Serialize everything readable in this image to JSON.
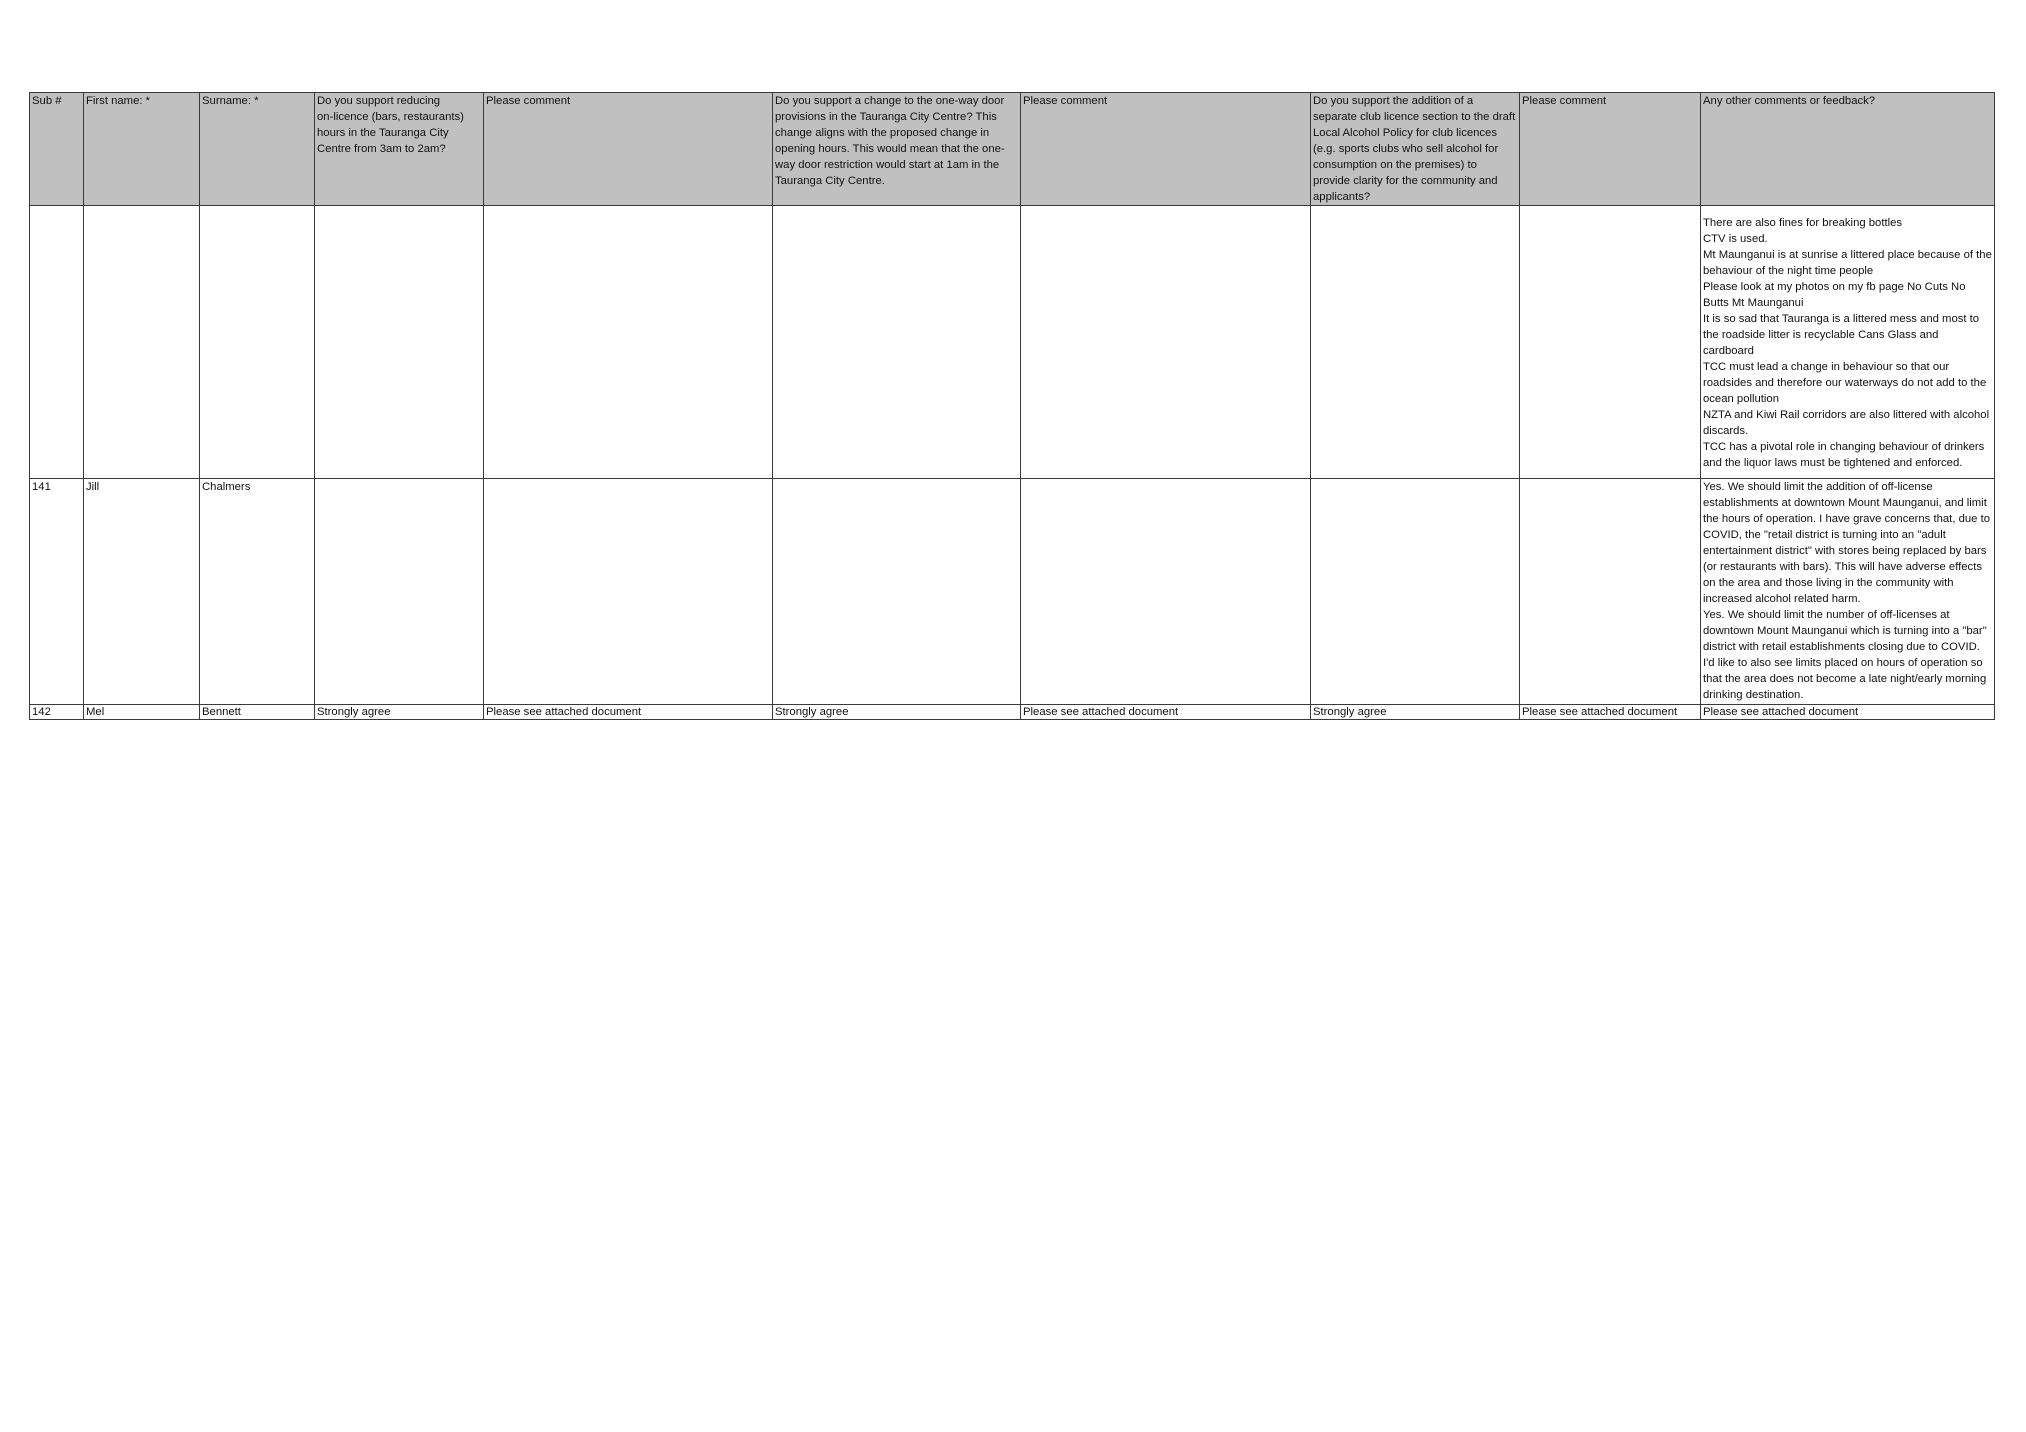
{
  "table": {
    "headers": [
      "Sub #",
      "First name: *",
      "Surname: *",
      "Do you support reducing\n on-licence (bars, restaurants) hours in the Tauranga City Centre from 3am to 2am?",
      "Please comment",
      "Do you support a change to the one-way door provisions in the Tauranga City Centre? This change aligns with the proposed change in opening hours. This would mean that the one-way door restriction would start at 1am in the Tauranga City Centre.",
      "Please comment",
      "Do you support the addition of a separate club licence section to the draft Local Alcohol Policy for club licences (e.g. sports clubs who sell alcohol for consumption on the premises) to provide clarity for the community and applicants?",
      "Please comment",
      "Any other comments or feedback?"
    ],
    "rows": [
      {
        "sub": "",
        "first": "",
        "surname": "",
        "q1": "",
        "c1": "",
        "q2": "",
        "c2": "",
        "q3": "",
        "c3": "",
        "other": [
          "There are also fines for breaking bottles",
          "CTV is used.",
          "Mt Maunganui is at sunrise a littered place because of the behaviour of the night time people",
          "Please look at my photos on my fb page No Cuts No Butts Mt Maunganui",
          "It is so sad that Tauranga is a littered mess and most to the roadside litter is recyclable Cans Glass and cardboard",
          "TCC must lead a change in behaviour so that our roadsides and therefore our waterways do not add to the ocean pollution",
          "NZTA and Kiwi Rail corridors are also littered with alcohol discards.",
          "TCC has a pivotal role in changing behaviour of drinkers and the liquor laws must be tightened and enforced."
        ]
      },
      {
        "sub": "141",
        "first": "Jill",
        "surname": "Chalmers",
        "q1": "",
        "c1": "",
        "q2": "",
        "c2": "",
        "q3": "",
        "c3": "",
        "other": [
          "Yes.  We should limit the addition of off-license establishments at downtown Mount Maunganui, and limit the hours of operation.  I have grave concerns that, due to COVID, the \"retail district is turning into an \"adult entertainment district\" with stores being replaced by bars (or restaurants with bars).  This will have adverse effects on the area and those living in the community with increased alcohol related harm.",
          "Yes.  We should limit the number of off-licenses at downtown Mount Maunganui which is turning into a \"bar\" district with retail establishments closing due to COVID.  I'd like to also see limits placed on hours of operation so that the area does not become a late night/early morning drinking destination."
        ]
      },
      {
        "sub": "142",
        "first": "Mel",
        "surname": "Bennett",
        "q1": "Strongly agree",
        "c1": "Please see attached document",
        "q2": "Strongly agree",
        "c2": "Please see attached document",
        "q3": "Strongly agree",
        "c3": "Please see attached document",
        "other": [
          "Please see attached document"
        ]
      }
    ]
  }
}
